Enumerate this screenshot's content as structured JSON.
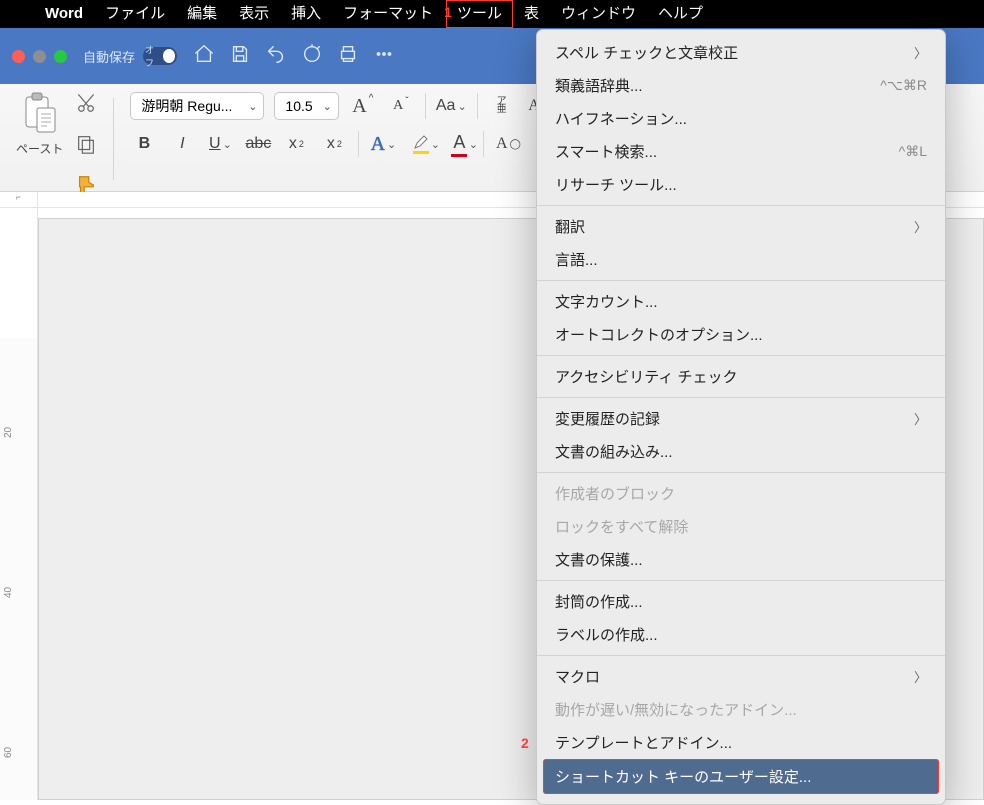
{
  "menubar": {
    "app": "Word",
    "items": [
      "ファイル",
      "編集",
      "表示",
      "挿入",
      "フォーマット",
      "ツール",
      "表",
      "ウィンドウ",
      "ヘルプ"
    ],
    "active_index": 5
  },
  "callouts": {
    "one": "1",
    "two": "2"
  },
  "titlebar": {
    "autosave_label": "自動保存",
    "autosave_off": "オフ"
  },
  "ribbon": {
    "paste_label": "ペースト",
    "font_name": "游明朝 Regu...",
    "font_size": "10.5",
    "strike_label": "abc",
    "case_label": "Aa",
    "x2_sub": "x",
    "x2_sup": "x",
    "ruby_top": "ア",
    "ruby_bottom": "亜"
  },
  "ruler": {
    "corner": "⌐",
    "v_20": "20",
    "v_40": "40",
    "v_60": "60"
  },
  "menu": {
    "items": [
      {
        "label": "スペル チェックと文章校正",
        "arrow": true
      },
      {
        "label": "類義語辞典...",
        "shortcut": "^⌥⌘R"
      },
      {
        "label": "ハイフネーション..."
      },
      {
        "label": "スマート検索...",
        "shortcut": "^⌘L"
      },
      {
        "label": "リサーチ ツール..."
      },
      {
        "sep": true
      },
      {
        "label": "翻訳",
        "arrow": true
      },
      {
        "label": "言語..."
      },
      {
        "sep": true
      },
      {
        "label": "文字カウント..."
      },
      {
        "label": "オートコレクトのオプション..."
      },
      {
        "sep": true
      },
      {
        "label": "アクセシビリティ チェック"
      },
      {
        "sep": true
      },
      {
        "label": "変更履歴の記録",
        "arrow": true
      },
      {
        "label": "文書の組み込み..."
      },
      {
        "sep": true
      },
      {
        "label": "作成者のブロック",
        "disabled": true
      },
      {
        "label": "ロックをすべて解除",
        "disabled": true
      },
      {
        "label": "文書の保護..."
      },
      {
        "sep": true
      },
      {
        "label": "封筒の作成..."
      },
      {
        "label": "ラベルの作成..."
      },
      {
        "sep": true
      },
      {
        "label": "マクロ",
        "arrow": true
      },
      {
        "label": "動作が遅い/無効になったアドイン...",
        "disabled": true
      },
      {
        "label": "テンプレートとアドイン...",
        "callout": true
      },
      {
        "label": "ショートカット キーのユーザー設定...",
        "selected": true
      }
    ]
  }
}
